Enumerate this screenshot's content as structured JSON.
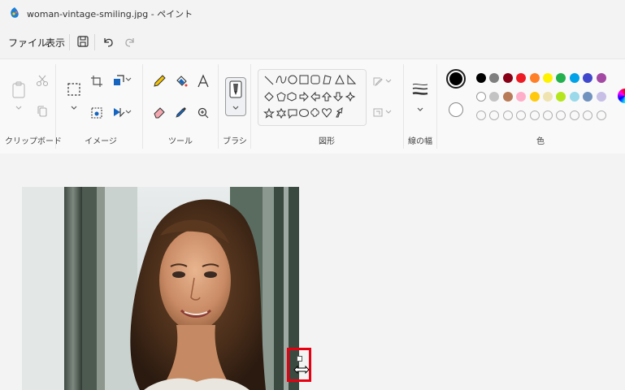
{
  "window": {
    "title": "woman-vintage-smiling.jpg - ペイント"
  },
  "menu": {
    "file": "ファイル",
    "view": "表示"
  },
  "ribbon": {
    "groups": {
      "clipboard": "クリップボード",
      "image": "イメージ",
      "tools": "ツール",
      "brush": "ブラシ",
      "shapes": "図形",
      "size": "線の幅",
      "colors": "色"
    }
  },
  "colors": {
    "primary": "#000000",
    "secondary": "#ffffff",
    "row1": [
      "#000000",
      "#7f7f7f",
      "#880015",
      "#ed1c24",
      "#ff7f27",
      "#fff200",
      "#22b14c",
      "#00a2e8",
      "#3f48cc",
      "#a349a4"
    ],
    "row2": [
      "#ffffff",
      "#c3c3c3",
      "#b97a57",
      "#ffaec9",
      "#ffc90e",
      "#efe4b0",
      "#b5e61d",
      "#99d9ea",
      "#7092be",
      "#c8bfe7"
    ],
    "row3_empty_count": 10
  },
  "canvas": {
    "image": "photo-woman-vintage-smiling"
  }
}
